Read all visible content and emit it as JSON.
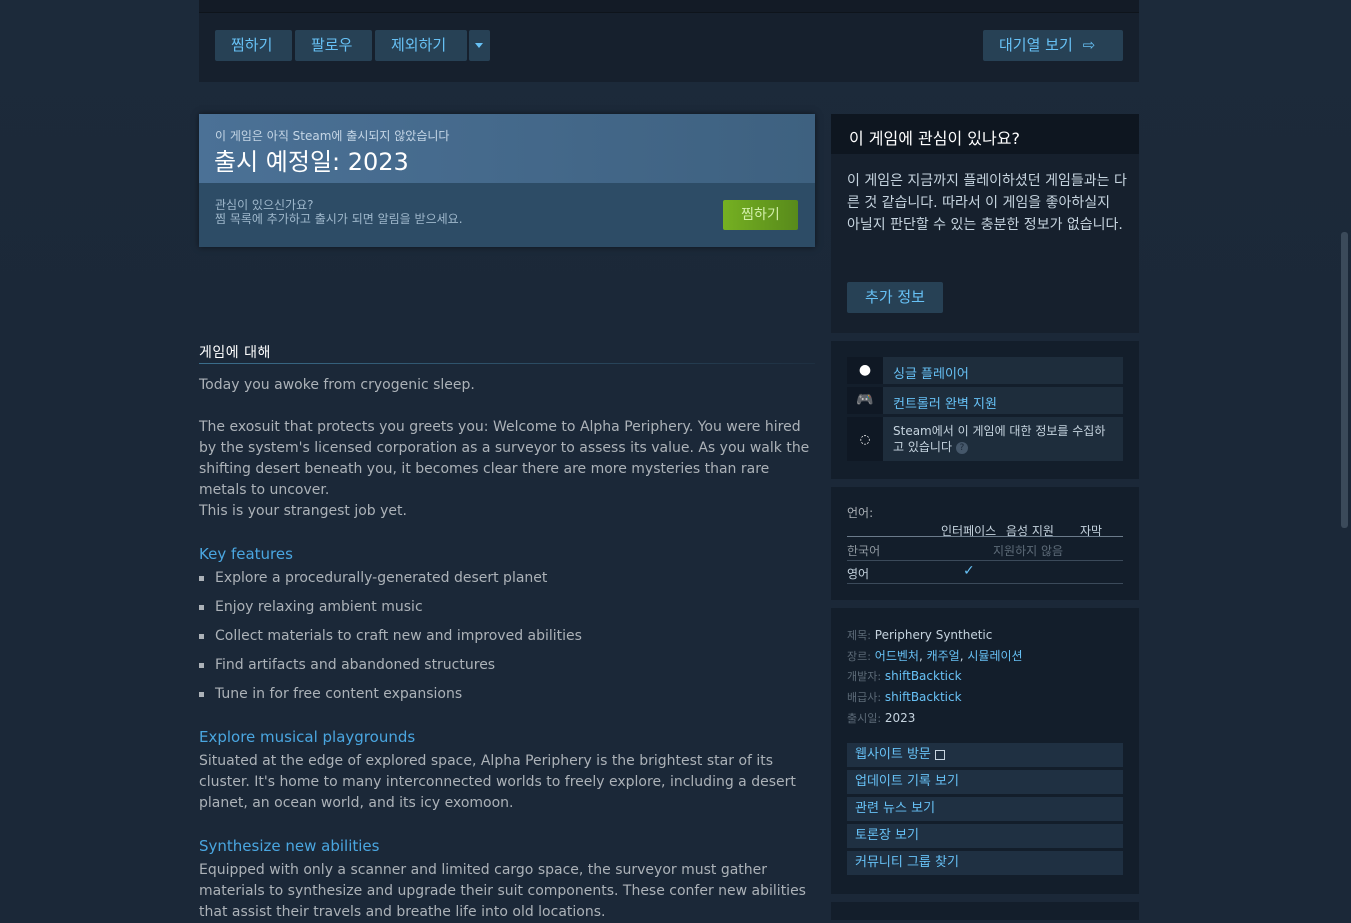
{
  "actions": {
    "wishlist": "찜하기",
    "follow": "팔로우",
    "ignore": "제외하기",
    "queue": "대기열 보기"
  },
  "coming_soon": {
    "not_released": "이 게임은 아직 Steam에 출시되지 않았습니다",
    "release_date": "출시 예정일: 2023",
    "interest_line1": "관심이 있으신가요?",
    "interest_line2": "찜 목록에 추가하고 출시가 되면 알림을 받으세요.",
    "wishlist_button": "찜하기"
  },
  "about": {
    "title": "게임에 대해",
    "p1": "Today you awoke from cryogenic sleep.",
    "p2": "The exosuit that protects you greets you: Welcome to Alpha Periphery. You were hired by the system's licensed corporation as a surveyor to assess its value. As you walk the shifting desert beneath you, it becomes clear there are more mysteries than rare metals to uncover.",
    "p3": "This is your strangest job yet.",
    "features_heading": "Key features",
    "features": [
      "Explore a procedurally-generated desert planet",
      "Enjoy relaxing ambient music",
      "Collect materials to craft new and improved abilities",
      "Find artifacts and abandoned structures",
      "Tune in for free content expansions"
    ],
    "h2": "Explore musical playgrounds",
    "p4": "Situated at the edge of explored space, Alpha Periphery is the brightest star of its cluster. It's home to many interconnected worlds to freely explore, including a desert planet, an ocean world, and its icy exomoon.",
    "h3": "Synthesize new abilities",
    "p5": "Equipped with only a scanner and limited cargo space, the surveyor must gather materials to synthesize and upgrade their suit components. These confer new abilities that assist their travels and breathe life into old locations."
  },
  "interest_panel": {
    "title": "이 게임에 관심이 있나요?",
    "text": "이 게임은 지금까지 플레이하셨던 게임들과는 다른 것 같습니다. 따라서 이 게임을 좋아하실지 아닐지 판단할 수 있는 충분한 정보가 없습니다.",
    "button": "추가 정보"
  },
  "features_panel": {
    "single": "싱글 플레이어",
    "controller": "컨트롤러 완벽 지원",
    "collecting": "Steam에서 이 게임에 대한 정보를 수집하고 있습니다",
    "help": "?"
  },
  "languages": {
    "label": "언어:",
    "col_interface": "인터페이스",
    "col_audio": "음성 지원",
    "col_subtitles": "자막",
    "rows": [
      {
        "name": "한국어",
        "status": "지원하지 않음",
        "check": ""
      },
      {
        "name": "영어",
        "status": "",
        "check": "✓"
      }
    ]
  },
  "details": {
    "title_key": "제목:",
    "title_val": "Periphery Synthetic",
    "genre_key": "장르:",
    "genre_vals": [
      "어드벤처",
      "캐주얼",
      "시뮬레이션"
    ],
    "genre_sep": ", ",
    "dev_key": "개발자:",
    "dev_val": "shiftBacktick",
    "pub_key": "배급사:",
    "pub_val": "shiftBacktick",
    "date_key": "출시일:",
    "date_val": "2023"
  },
  "links": [
    "웹사이트 방문",
    "업데이트 기록 보기",
    "관련 뉴스 보기",
    "토론장 보기",
    "커뮤니티 그룹 찾기"
  ]
}
